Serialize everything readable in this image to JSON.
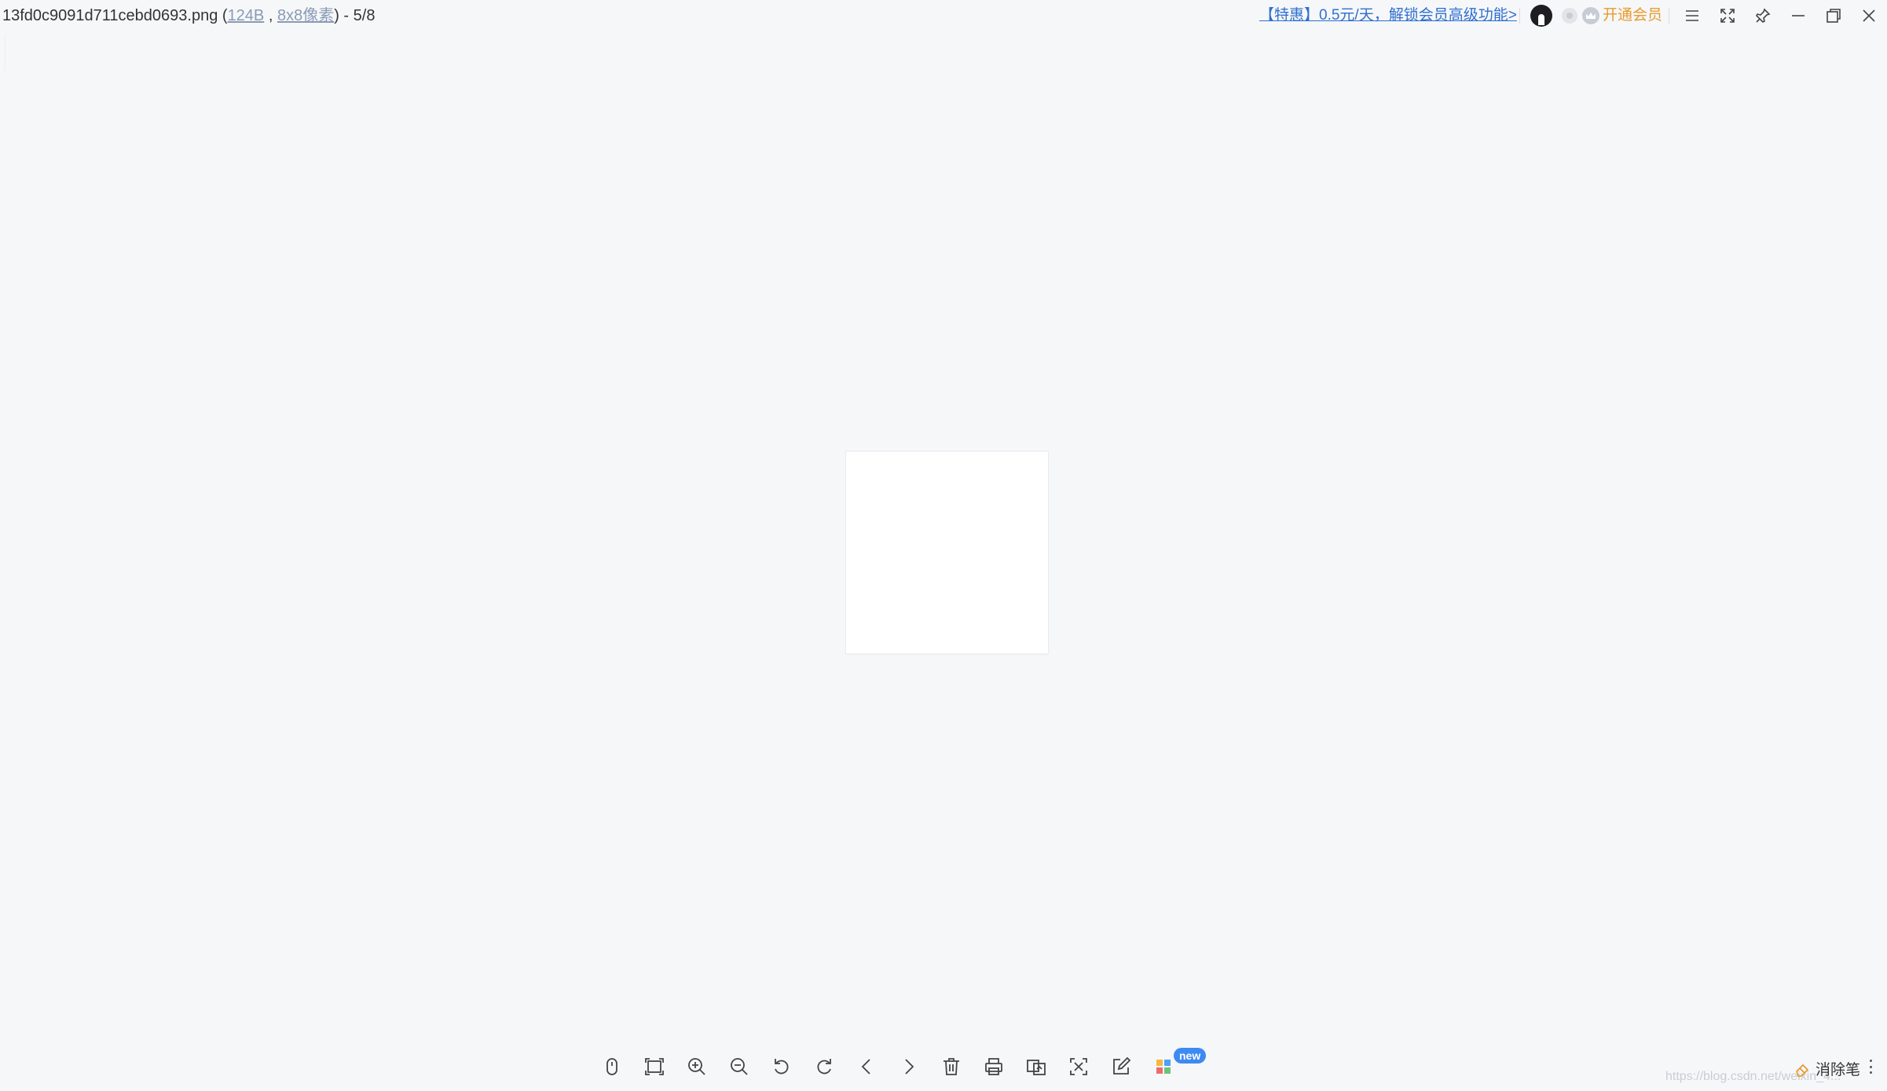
{
  "titlebar": {
    "filename": "13fd0c9091d711cebd0693.png",
    "size": "124B",
    "dimensions": "8x8像素",
    "position": "5/8",
    "promo": "【特惠】0.5元/天，解锁会员高级功能>",
    "vip_label": "开通会员"
  },
  "toolbar": {
    "new_tag": "new",
    "eraser_label": "消除笔"
  },
  "watermark": "https://blog.csdn.net/weixin_4..."
}
